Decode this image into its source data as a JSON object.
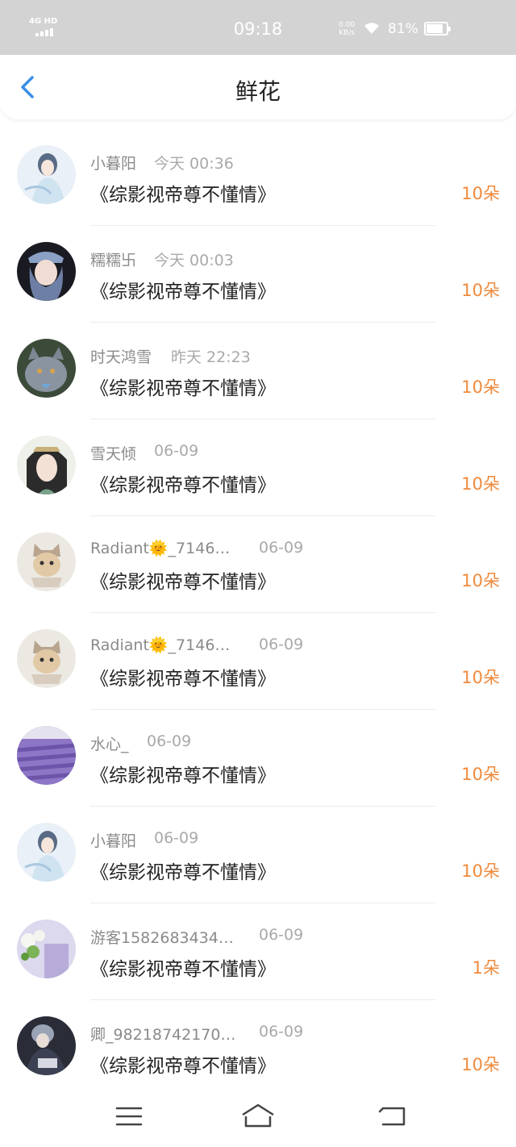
{
  "status_bar": {
    "network": "4G HD",
    "time": "09:18",
    "speed_value": "0.00",
    "speed_unit": "KB/s",
    "battery": "81%"
  },
  "header": {
    "title": "鲜花",
    "back_icon": "chevron-left-icon"
  },
  "colors": {
    "accent": "#3a8ee6",
    "count": "#f08a3c",
    "status_bar_bg": "#d3d3d3"
  },
  "list": [
    {
      "name": "小暮阳",
      "date": "今天 00:36",
      "book": "《综影视帝尊不懂情》",
      "count": "10朵",
      "avatar": "anime-girl-avatar"
    },
    {
      "name": "糯糯卐",
      "date": "今天 00:03",
      "book": "《综影视帝尊不懂情》",
      "count": "10朵",
      "avatar": "girl-with-hat-avatar"
    },
    {
      "name": "时天鸿雪",
      "date": "昨天 22:23",
      "book": "《综影视帝尊不懂情》",
      "count": "10朵",
      "avatar": "gray-cat-avatar"
    },
    {
      "name": "雪天倾",
      "date": "06-09",
      "book": "《综影视帝尊不懂情》",
      "count": "10朵",
      "avatar": "costume-actress-avatar"
    },
    {
      "name": "Radiant🌞_7146…",
      "date": "06-09",
      "book": "《综影视帝尊不懂情》",
      "count": "10朵",
      "avatar": "kitten-in-hat-avatar"
    },
    {
      "name": "Radiant🌞_7146…",
      "date": "06-09",
      "book": "《综影视帝尊不懂情》",
      "count": "10朵",
      "avatar": "kitten-in-hat-avatar"
    },
    {
      "name": "水心_",
      "date": "06-09",
      "book": "《综影视帝尊不懂情》",
      "count": "10朵",
      "avatar": "lavender-field-avatar"
    },
    {
      "name": "小暮阳",
      "date": "06-09",
      "book": "《综影视帝尊不懂情》",
      "count": "10朵",
      "avatar": "anime-girl-avatar"
    },
    {
      "name": "游客1582683434…",
      "date": "06-09",
      "book": "《综影视帝尊不懂情》",
      "count": "1朵",
      "avatar": "flowers-avatar"
    },
    {
      "name": "卿_98218742170…",
      "date": "06-09",
      "book": "《综影视帝尊不懂情》",
      "count": "10朵",
      "avatar": "anime-boy-avatar"
    }
  ],
  "navbar": {
    "menu_icon": "menu-icon",
    "home_icon": "home-icon",
    "back_icon": "back-icon"
  }
}
